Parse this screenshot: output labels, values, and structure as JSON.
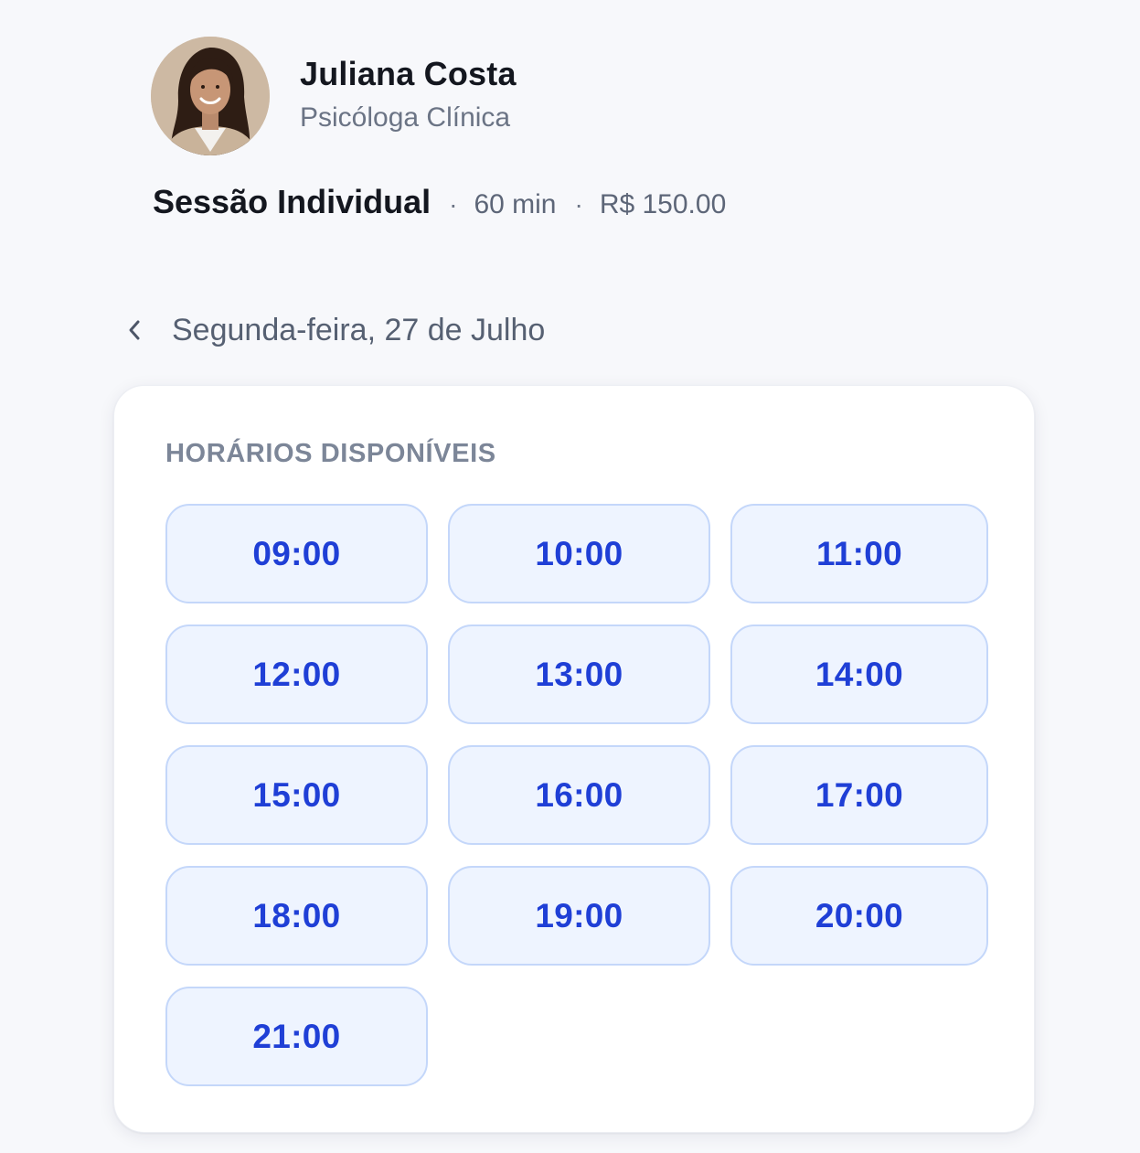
{
  "profile": {
    "name": "Juliana Costa",
    "role": "Psicóloga Clínica"
  },
  "service": {
    "name": "Sessão Individual",
    "separator": "·",
    "duration": "60 min",
    "price": "R$ 150.00"
  },
  "date_nav": {
    "back_icon": "chevron-left-icon",
    "date_label": "Segunda-feira, 27 de Julho"
  },
  "slots_card": {
    "heading": "HORÁRIOS DISPONÍVEIS",
    "slots": [
      "09:00",
      "10:00",
      "11:00",
      "12:00",
      "13:00",
      "14:00",
      "15:00",
      "16:00",
      "17:00",
      "18:00",
      "19:00",
      "20:00",
      "21:00"
    ]
  },
  "colors": {
    "slot_text": "#1f3fd6",
    "slot_background": "#eef4ff",
    "slot_border": "#c4d7fa",
    "page_background": "#f7f8fb"
  }
}
